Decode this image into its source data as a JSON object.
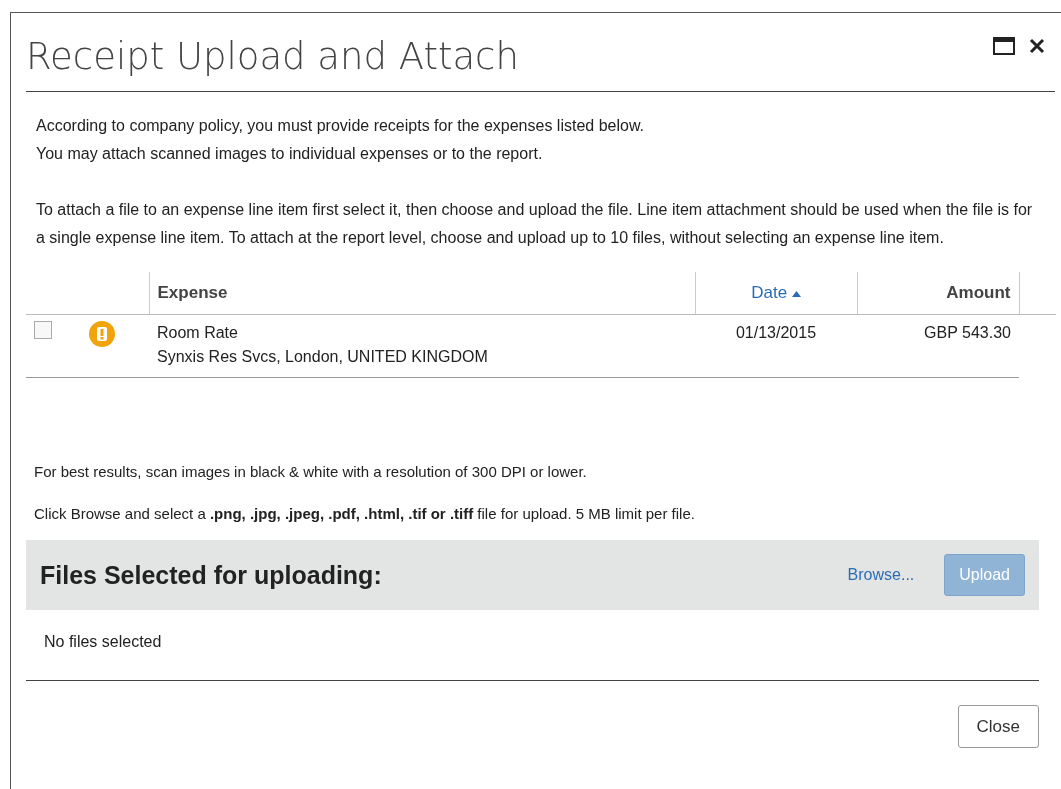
{
  "window": {
    "title": "Receipt Upload and Attach"
  },
  "intro": [
    "According to company policy, you must provide receipts for the expenses listed below.",
    "You may attach scanned images to individual expenses or to the report."
  ],
  "instructions": "To attach a file to an expense line item first select it, then choose and upload the file. Line item attachment should be used when the file is for a single expense line item. To attach at the report level, choose and upload up to 10 files, without selecting an expense line item.",
  "table": {
    "columns": [
      {
        "label": "Expense",
        "sorted": false
      },
      {
        "label": "Date",
        "sorted": true
      },
      {
        "label": "Amount",
        "sorted": false
      }
    ],
    "rows": [
      {
        "checked": false,
        "alert": true,
        "expense": "Room Rate",
        "vendor": "Synxis Res Svcs, London, UNITED KINGDOM",
        "date": "01/13/2015",
        "amount": "GBP 543.30"
      }
    ]
  },
  "hints": [
    "For best results, scan images in black & white with a resolution of 300 DPI or lower.",
    "Click Browse and select a **.png, .jpg, .jpeg, .pdf, .html, .tif or .tiff** file for upload. 5 MB limit per file."
  ],
  "files": {
    "heading": "Files Selected for uploading:",
    "browse": "Browse...",
    "upload": {
      "label": "Upload",
      "disabled": true
    },
    "empty": "No files selected"
  },
  "buttons": [
    "Close"
  ]
}
